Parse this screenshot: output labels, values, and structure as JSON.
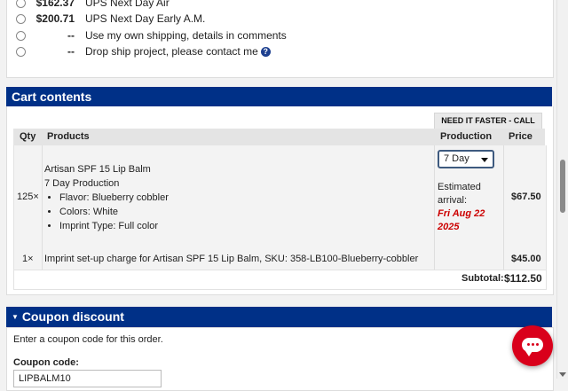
{
  "shipping": {
    "options": [
      {
        "price": "$162.37",
        "label": "UPS Next Day Air"
      },
      {
        "price": "$200.71",
        "label": "UPS Next Day Early A.M."
      },
      {
        "price": "--",
        "label": "Use my own shipping, details in comments"
      },
      {
        "price": "--",
        "label": "Drop ship project, please contact me"
      }
    ],
    "help_glyph": "?"
  },
  "cart": {
    "header": "Cart contents",
    "need_it_faster": "NEED IT FASTER - CALL",
    "columns": {
      "qty": "Qty",
      "products": "Products",
      "production": "Production",
      "price": "Price"
    },
    "items": [
      {
        "qty": "125×",
        "name": "Artisan SPF 15 Lip Balm",
        "production_note": "7 Day Production",
        "attributes": [
          "Flavor: Blueberry cobbler",
          "Colors: White",
          "Imprint Type: Full color"
        ],
        "production_select": "7 Day",
        "arrival_label_1": "Estimated",
        "arrival_label_2": "arrival:",
        "arrival_date_1": "Fri Aug 22",
        "arrival_date_2": "2025",
        "price": "$67.50"
      },
      {
        "qty": "1×",
        "name": "Imprint set-up charge for Artisan SPF 15 Lip Balm, SKU: 358-LB100-Blueberry-cobbler",
        "price": "$45.00"
      }
    ],
    "subtotal_label": "Subtotal:",
    "subtotal_value": "$112.50"
  },
  "coupon": {
    "header": "Coupon discount",
    "description": "Enter a coupon code for this order.",
    "label": "Coupon code:",
    "value": "LIPBALM10"
  },
  "colors": {
    "accent": "#003087",
    "chat": "#d9001b",
    "arrival": "#cc0000"
  },
  "icons": {
    "chat": "chat-bubble-icon",
    "help": "question-circle-icon",
    "collapse": "triangle-down-icon",
    "select": "caret-down-icon"
  }
}
